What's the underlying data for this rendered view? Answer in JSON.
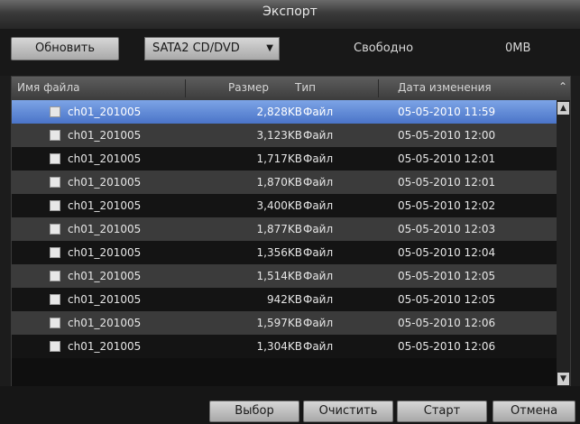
{
  "window": {
    "title": "Экспорт"
  },
  "toolbar": {
    "refresh_label": "Обновить",
    "device_selected": "SATA2 CD/DVD",
    "free_label": "Свободно",
    "free_value": "0MB"
  },
  "table": {
    "columns": [
      "Имя файла",
      "Размер",
      "Тип",
      "Дата изменения"
    ],
    "rows": [
      {
        "name": "ch01_201005",
        "size": "2,828KB",
        "type": "Файл",
        "date": "05-05-2010 11:59"
      },
      {
        "name": "ch01_201005",
        "size": "3,123KB",
        "type": "Файл",
        "date": "05-05-2010 12:00"
      },
      {
        "name": "ch01_201005",
        "size": "1,717KB",
        "type": "Файл",
        "date": "05-05-2010 12:01"
      },
      {
        "name": "ch01_201005",
        "size": "1,870KB",
        "type": "Файл",
        "date": "05-05-2010 12:01"
      },
      {
        "name": "ch01_201005",
        "size": "3,400KB",
        "type": "Файл",
        "date": "05-05-2010 12:02"
      },
      {
        "name": "ch01_201005",
        "size": "1,877KB",
        "type": "Файл",
        "date": "05-05-2010 12:03"
      },
      {
        "name": "ch01_201005",
        "size": "1,356KB",
        "type": "Файл",
        "date": "05-05-2010 12:04"
      },
      {
        "name": "ch01_201005",
        "size": "1,514KB",
        "type": "Файл",
        "date": "05-05-2010 12:05"
      },
      {
        "name": "ch01_201005",
        "size": "942KB",
        "type": "Файл",
        "date": "05-05-2010 12:05"
      },
      {
        "name": "ch01_201005",
        "size": "1,597KB",
        "type": "Файл",
        "date": "05-05-2010 12:06"
      },
      {
        "name": "ch01_201005",
        "size": "1,304KB",
        "type": "Файл",
        "date": "05-05-2010 12:06"
      }
    ],
    "selected_index": 0
  },
  "footer": {
    "backup_label": "Выбор",
    "clear_label": "Очистить",
    "start_label": "Старт",
    "cancel_label": "Отмена"
  },
  "icons": {
    "dropdown": "chevron-down-icon",
    "scroll_up": "chevron-up-icon",
    "scroll_down": "chevron-down-icon"
  },
  "colors": {
    "selected_row": "#4a74c8",
    "button_face": "#c4c4c4",
    "background": "#1c1c1c"
  }
}
